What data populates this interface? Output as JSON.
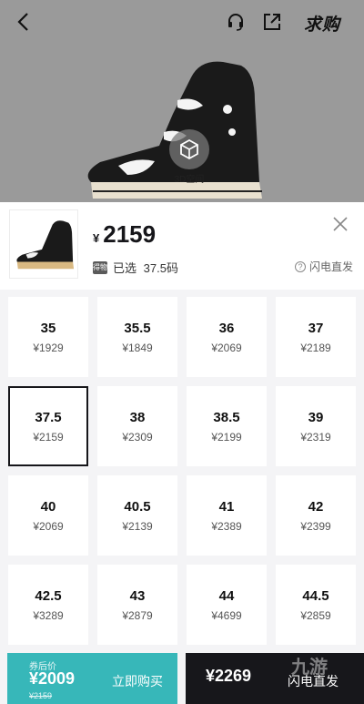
{
  "header": {
    "buy_request_label": "求购",
    "badge_3d_label": "3D空间"
  },
  "product": {
    "currency": "¥",
    "price": "2159",
    "selected_prefix": "已选",
    "selected_size": "37.5码",
    "flash_label": "闪电直发",
    "badge_text": "得物"
  },
  "sizes": [
    {
      "size": "35",
      "price": "¥1929"
    },
    {
      "size": "35.5",
      "price": "¥1849"
    },
    {
      "size": "36",
      "price": "¥2069"
    },
    {
      "size": "37",
      "price": "¥2189"
    },
    {
      "size": "37.5",
      "price": "¥2159"
    },
    {
      "size": "38",
      "price": "¥2309"
    },
    {
      "size": "38.5",
      "price": "¥2199"
    },
    {
      "size": "39",
      "price": "¥2319"
    },
    {
      "size": "40",
      "price": "¥2069"
    },
    {
      "size": "40.5",
      "price": "¥2139"
    },
    {
      "size": "41",
      "price": "¥2389"
    },
    {
      "size": "42",
      "price": "¥2399"
    },
    {
      "size": "42.5",
      "price": "¥3289"
    },
    {
      "size": "43",
      "price": "¥2879"
    },
    {
      "size": "44",
      "price": "¥4699"
    },
    {
      "size": "44.5",
      "price": "¥2859"
    }
  ],
  "selected_index": 4,
  "bottom": {
    "coupon_label": "券后价",
    "coupon_price": "¥2009",
    "original_price": "¥2159",
    "buy_now_label": "立即购买",
    "flash_price": "¥2269",
    "flash_label": "闪电直发"
  },
  "watermark": "九游"
}
